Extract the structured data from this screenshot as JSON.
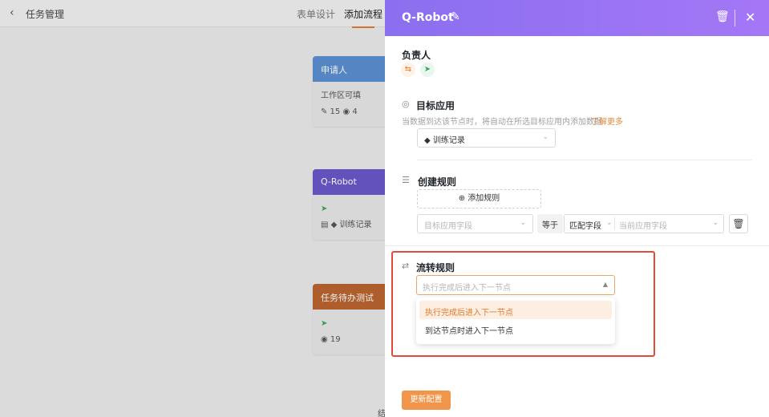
{
  "background": {
    "back_icon": "chevron-left-icon",
    "title": "任务管理",
    "tabs": [
      "表单设计",
      "添加流程"
    ],
    "cards": [
      {
        "header": "申请人",
        "line1": "工作区可填",
        "line2": "✎ 15  ◉ 4"
      },
      {
        "header": "Q-Robot",
        "line1": "➤",
        "line2": "▤ ◆ 训练记录"
      },
      {
        "header": "任务待办测试",
        "line1": "➤",
        "line2": "◉ 19"
      }
    ],
    "footer_text": "结"
  },
  "drawer": {
    "title": "Q-Robot",
    "owner": {
      "label": "负责人"
    },
    "target_app": {
      "title": "目标应用",
      "hint": "当数据到达该节点时，将自动在所选目标应用内添加数据",
      "learn_more": "了解更多",
      "selected": "◆ 训练记录"
    },
    "create_rules": {
      "title": "创建规则",
      "add_button": "⊕ 添加规则",
      "target_field_placeholder": "目标应用字段",
      "equals": "等于",
      "match_type": "匹配字段",
      "current_field_placeholder": "当前应用字段"
    },
    "flow_rules": {
      "title": "流转规则",
      "placeholder": "执行完成后进入下一节点",
      "options": [
        "执行完成后进入下一节点",
        "到达节点时进入下一节点"
      ]
    },
    "update_button": "更新配置"
  },
  "colors": {
    "accent": "#f0954a",
    "header_gradient": [
      "#8a6ff0",
      "#a477f6"
    ],
    "highlight": "#e24a3b"
  }
}
